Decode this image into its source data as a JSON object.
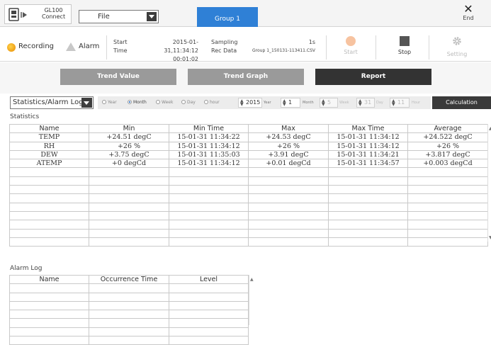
{
  "top": {
    "device_line1": "GL100",
    "device_line2": "Connect",
    "file_label": "File",
    "group_tab": "Group 1",
    "end_label": "End"
  },
  "status": {
    "recording_label": "Recording",
    "alarm_label": "Alarm",
    "start_label": "Start",
    "start_value": "2015-01-31,11:34:12",
    "time_label": "Time",
    "time_value": "00:01:02",
    "sampling_label": "Sampling",
    "sampling_value": "1s",
    "recdata_label": "Rec Data",
    "recdata_value": "Group 1_150131-113411.CSV",
    "start_btn": "Start",
    "stop_btn": "Stop",
    "setting_btn": "Setting"
  },
  "views": {
    "trend_value": "Trend Value",
    "trend_graph": "Trend Graph",
    "report": "Report"
  },
  "selector": {
    "log_select": "Statistics/Alarm Log",
    "radios": [
      "Year",
      "Month",
      "Week",
      "Day",
      "hour"
    ],
    "selected_radio": "Month",
    "year_value": "2015",
    "year_unit": "Year",
    "month_value": "1",
    "month_unit": "Month",
    "week_value": "5",
    "week_unit": "Week",
    "day_value": "31",
    "day_unit": "Day",
    "hour_value": "11",
    "hour_unit": "Hour",
    "calc_btn": "Calculation"
  },
  "statistics": {
    "title": "Statistics",
    "headers": [
      "Name",
      "Min",
      "Min Time",
      "Max",
      "Max Time",
      "Average"
    ],
    "rows": [
      [
        "TEMP",
        "+24.51 degC",
        "15-01-31 11:34:22",
        "+24.53 degC",
        "15-01-31 11:34:12",
        "+24.522 degC"
      ],
      [
        "RH",
        "+26 %",
        "15-01-31 11:34:12",
        "+26 %",
        "15-01-31 11:34:12",
        "+26 %"
      ],
      [
        "DEW",
        "+3.75 degC",
        "15-01-31 11:35:03",
        "+3.91 degC",
        "15-01-31 11:34:21",
        "+3.817 degC"
      ],
      [
        "ATEMP",
        "+0 degCd",
        "15-01-31 11:34:12",
        "+0.01 degCd",
        "15-01-31 11:34:57",
        "+0.003 degCd"
      ]
    ],
    "empty_rows": 9
  },
  "alarm_log": {
    "title": "Alarm Log",
    "headers": [
      "Name",
      "Occurrence Time",
      "Level"
    ],
    "rows": [],
    "empty_rows": 7
  }
}
